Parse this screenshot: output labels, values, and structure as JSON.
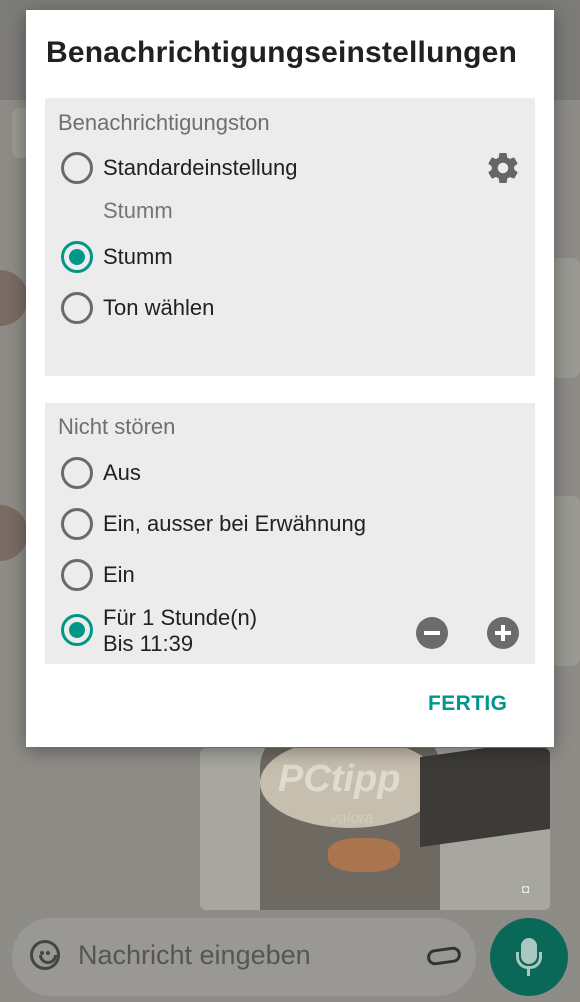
{
  "dialog": {
    "title": "Benachrichtigungseinstellungen",
    "done_label": "FERTIG"
  },
  "notification_tone": {
    "header": "Benachrichtigungston",
    "options": [
      {
        "label": "Standardeinstellung",
        "sublabel": "Stumm",
        "checked": false
      },
      {
        "label": "Stumm",
        "checked": true
      },
      {
        "label": "Ton wählen",
        "checked": false
      }
    ],
    "settings_icon": "gear-icon"
  },
  "do_not_disturb": {
    "header": "Nicht stören",
    "options": [
      {
        "label": "Aus",
        "checked": false
      },
      {
        "label": "Ein, ausser bei Erwähnung",
        "checked": false
      },
      {
        "label": "Ein",
        "checked": false
      },
      {
        "label": "Für 1 Stunde(n)",
        "sublabel": "Bis 11:39",
        "checked": true
      }
    ],
    "decrease_icon": "minus-circle-icon",
    "increase_icon": "plus-circle-icon"
  },
  "chat": {
    "input_placeholder": "Nachricht eingeben",
    "photo_brand": "PCtipp",
    "photo_brand_sub": "valora"
  },
  "colors": {
    "accent": "#009688",
    "mic_button": "#0a6858"
  }
}
